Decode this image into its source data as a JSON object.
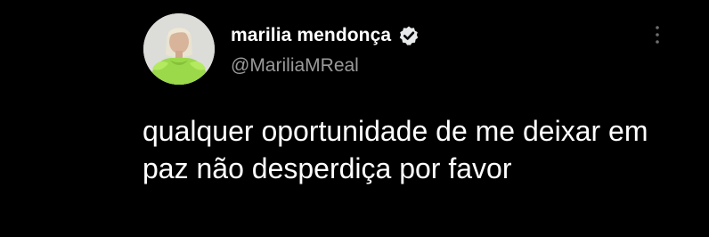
{
  "tweet": {
    "author": {
      "display_name": "marilia mendonça",
      "handle": "@MariliaMReal",
      "verified": true,
      "avatar_icon": "profile-photo",
      "verified_icon": "verified-badge-icon"
    },
    "more_icon": "more-vertical-icon",
    "text": "qualquer oportunidade de me deixar em paz não desperdiça por favor"
  },
  "theme": {
    "background": "#000000",
    "text_primary": "#ffffff",
    "text_secondary": "#9a9a9a",
    "verified_badge": "#e7e9ea",
    "avatar_accent": "#9bd94a"
  }
}
